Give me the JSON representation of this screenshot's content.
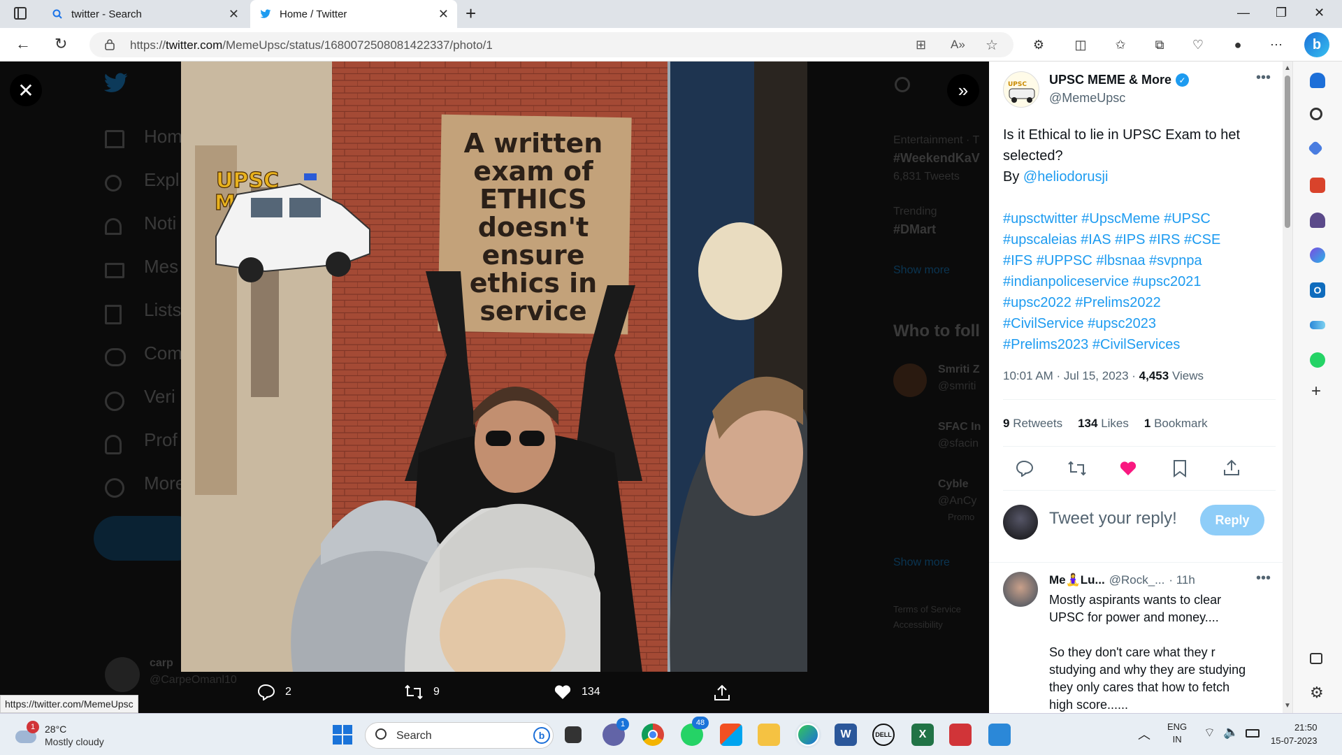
{
  "browser": {
    "tabs": [
      {
        "title": "twitter - Search"
      },
      {
        "title": "Home / Twitter"
      }
    ],
    "url_prefix": "https://",
    "url_host": "twitter.com",
    "url_path": "/MemeUpsc/status/1680072508081422337/photo/1",
    "status_url": "https://twitter.com/MemeUpsc"
  },
  "meme": {
    "sign_lines": [
      "A written",
      "exam of",
      "ETHICS",
      "doesn't",
      "ensure",
      "ethics in",
      "service"
    ],
    "logo_line1": "UPSC",
    "logo_line2": "MEME"
  },
  "photo_actions": {
    "replies": "2",
    "retweets": "9",
    "likes": "134"
  },
  "background": {
    "nav": [
      "Hom",
      "Expl",
      "Noti",
      "Mes",
      "Lists",
      "Com",
      "Veri",
      "Prof",
      "More"
    ],
    "trend_category": "Entertainment · T",
    "trend1": "#WeekendKaV",
    "trend1_count": "6,831 Tweets",
    "trend2_category": "Trending",
    "trend2": "#DMart",
    "show_more": "Show more",
    "who_to_follow": "Who to foll",
    "follow1": "Smriti Z",
    "follow1_handle": "@smriti",
    "follow2": "SFAC In",
    "follow2_handle": "@sfacin",
    "follow3": "Cyble",
    "follow3_handle": "@AnCy",
    "follow3_promo": "Promo",
    "show_more2": "Show more",
    "footer1": "Terms of Service",
    "footer2": "Accessibility",
    "user_name": "carp",
    "user_handle": "@CarpeOmanl10"
  },
  "tweet": {
    "author_name": "UPSC MEME & More",
    "author_handle": "@MemeUpsc",
    "text_line1": "Is it Ethical to lie in UPSC Exam to het",
    "text_line2": "selected?",
    "text_line3": "By @heliodorusji",
    "hashtags": [
      "#upsctwitter #UpscMeme #UPSC",
      "#upscaleias #IAS #IPS #IRS #CSE",
      "#IFS #UPPSC #lbsnaa #svpnpa",
      "#indianpoliceservice #upsc2021",
      "#upsc2022 #Prelims2022",
      "#CivilService #upsc2023",
      "#Prelims2023 #CivilServices"
    ],
    "timestamp": "10:01 AM · Jul 15, 2023 · ",
    "views_count": "4,453",
    "views_label": " Views",
    "retweets_count": "9",
    "retweets_label": "Retweets",
    "likes_count": "134",
    "likes_label": "Likes",
    "bookmarks_count": "1",
    "bookmarks_label": "Bookmark",
    "reply_placeholder": "Tweet your reply!",
    "reply_button": "Reply"
  },
  "reply": {
    "name": "Me🧘‍♀️Lu...",
    "handle": "@Rock_...",
    "time": "· 11h",
    "line1": "Mostly aspirants wants to clear",
    "line2": "UPSC for power and money....",
    "line3": "So they don't care what they r",
    "line4": "studying and why they are studying",
    "line5": "they only cares that how to fetch",
    "line6": "high score......"
  },
  "taskbar": {
    "weather_temp": "28°C",
    "weather_desc": "Mostly cloudy",
    "weather_badge": "1",
    "search_label": "Search",
    "teams_badge": "1",
    "whatsapp_badge": "48",
    "lang_top": "ENG",
    "lang_bottom": "IN",
    "time": "21:50",
    "date": "15-07-2023"
  },
  "colors": {
    "accent": "#1d9bf0",
    "like": "#f91880",
    "reply_btn": "#8ecdf8"
  }
}
